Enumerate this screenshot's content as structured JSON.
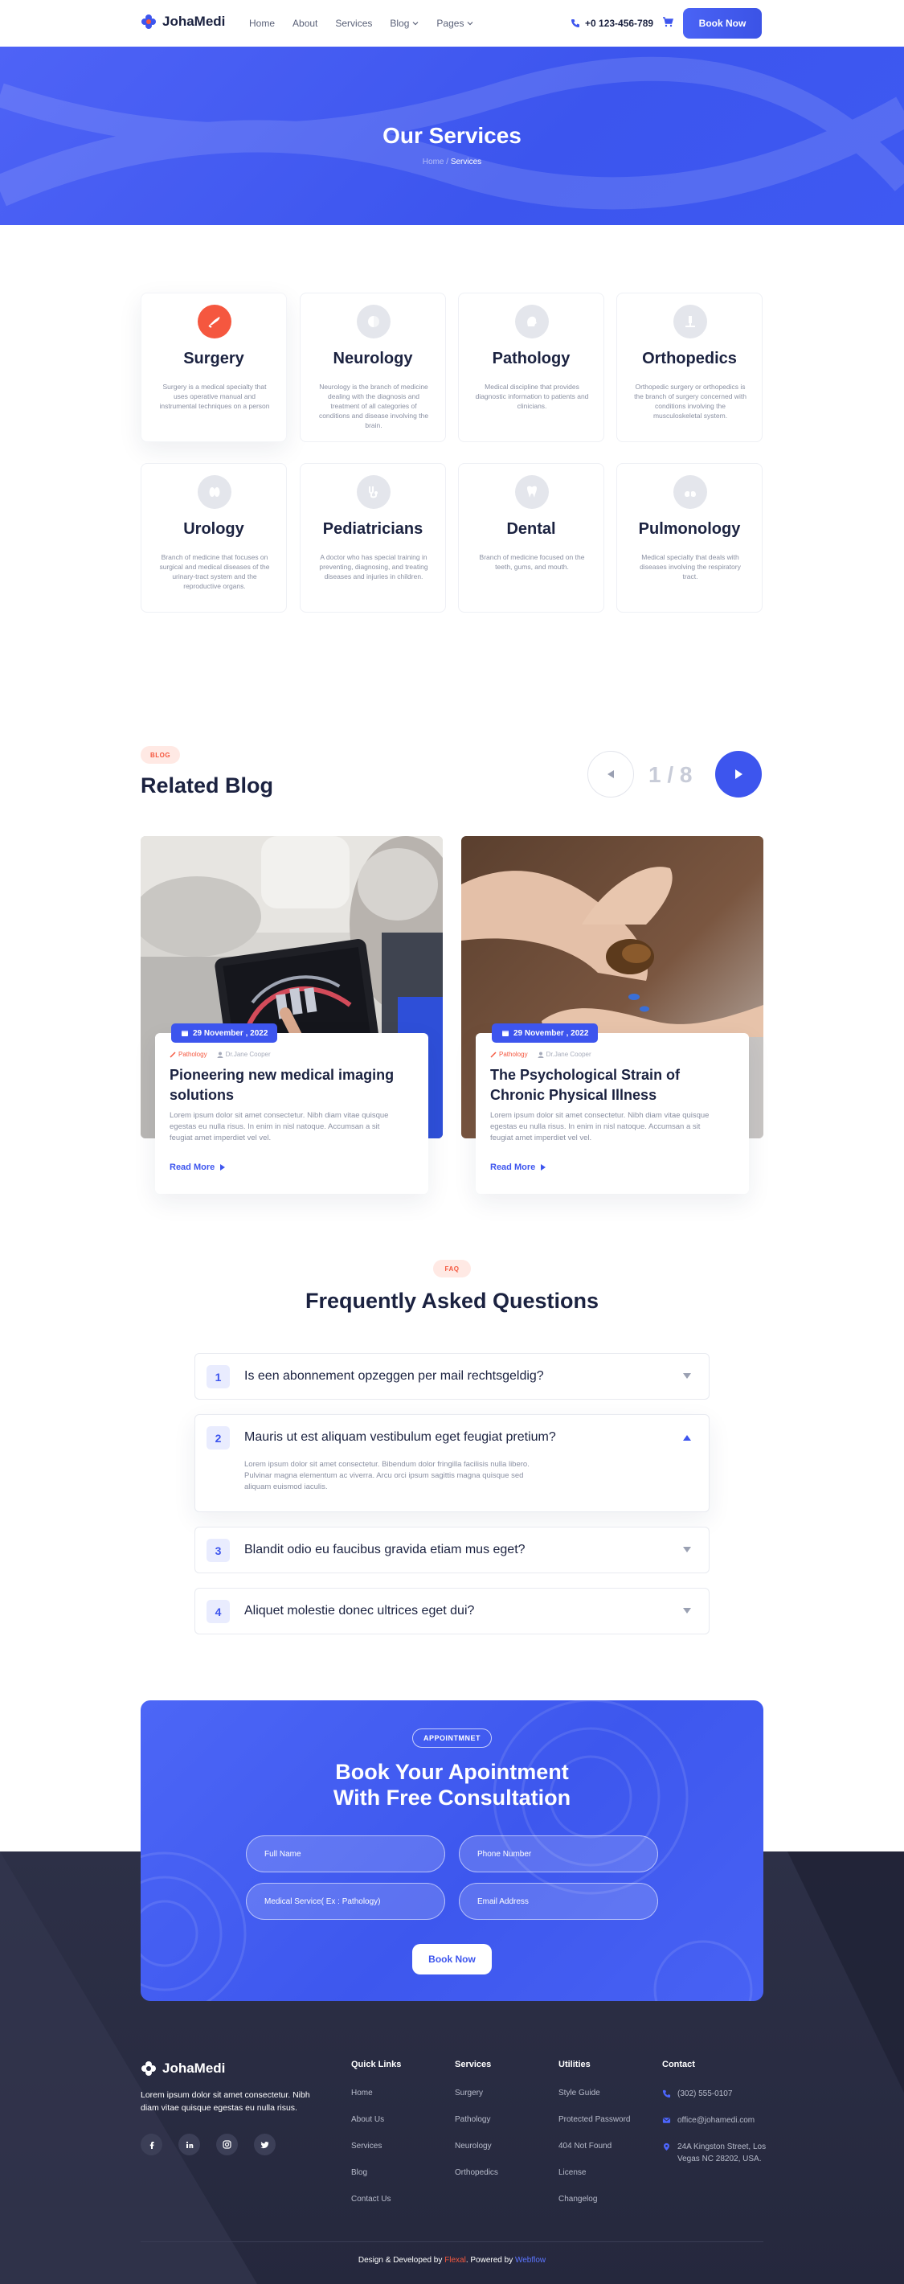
{
  "header": {
    "brand": "JohaMedi",
    "nav": [
      {
        "label": "Home"
      },
      {
        "label": "About"
      },
      {
        "label": "Services"
      },
      {
        "label": "Blog"
      },
      {
        "label": "Pages"
      }
    ],
    "phone": "+0 123-456-789",
    "book_now": "Book Now"
  },
  "hero": {
    "title": "Our Services",
    "breadcrumb_home": "Home",
    "breadcrumb_sep": "/",
    "breadcrumb_current": "Services"
  },
  "services": [
    {
      "title": "Surgery",
      "desc": "Surgery is a medical specialty that uses operative manual and instrumental techniques on a person",
      "icon": "scalpel-icon",
      "active": true
    },
    {
      "title": "Neurology",
      "desc": "Neurology is the branch of medicine dealing with the diagnosis and treatment of all categories of conditions and disease involving the brain.",
      "icon": "brain-icon",
      "active": false
    },
    {
      "title": "Pathology",
      "desc": "Medical discipline that provides diagnostic information to patients and clinicians.",
      "icon": "head-icon",
      "active": false
    },
    {
      "title": "Orthopedics",
      "desc": "Orthopedic surgery or orthopedics is the branch of surgery concerned with conditions involving the musculoskeletal system.",
      "icon": "microscope-icon",
      "active": false
    },
    {
      "title": "Urology",
      "desc": "Branch of medicine that focuses on surgical and medical diseases of the urinary-tract system and the reproductive organs.",
      "icon": "kidney-icon",
      "active": false
    },
    {
      "title": "Pediatricians",
      "desc": "A doctor who has special training in preventing, diagnosing, and treating diseases and injuries in children.",
      "icon": "stethoscope-icon",
      "active": false
    },
    {
      "title": "Dental",
      "desc": "Branch of medicine focused on the teeth, gums, and mouth.",
      "icon": "tooth-icon",
      "active": false
    },
    {
      "title": "Pulmonology",
      "desc": "Medical specialty that deals with diseases involving the respiratory tract.",
      "icon": "lungs-icon",
      "active": false
    }
  ],
  "blog": {
    "pill": "BLOG",
    "title": "Related Blog",
    "page_current": "1",
    "page_sep": "/",
    "page_total": "8",
    "posts": [
      {
        "date": "29 November , 2022",
        "category": "Pathology",
        "author": "Dr.Jane Cooper",
        "title": "Pioneering new medical imaging solutions",
        "excerpt": "Lorem ipsum dolor sit amet consectetur. Nibh diam vitae quisque egestas eu nulla risus. In enim in nisl natoque. Accumsan a sit feugiat amet imperdiet vel vel.",
        "read_more": "Read More"
      },
      {
        "date": "29 November , 2022",
        "category": "Pathology",
        "author": "Dr.Jane Cooper",
        "title": "The Psychological Strain of Chronic Physical Illness",
        "excerpt": "Lorem ipsum dolor sit amet consectetur. Nibh diam vitae quisque egestas eu nulla risus. In enim in nisl natoque. Accumsan a sit feugiat amet imperdiet vel vel.",
        "read_more": "Read More"
      }
    ]
  },
  "faq": {
    "pill": "FAQ",
    "title": "Frequently Asked Questions",
    "items": [
      {
        "num": "1",
        "question": "Is een abonnement opzeggen per mail rechtsgeldig?",
        "answer": "",
        "open": false
      },
      {
        "num": "2",
        "question": "Mauris ut est aliquam vestibulum eget feugiat pretium?",
        "answer": "Lorem ipsum dolor sit amet consectetur. Bibendum dolor fringilla facilisis nulla libero. Pulvinar magna elementum ac viverra. Arcu orci ipsum sagittis magna quisque sed aliquam euismod iaculis.",
        "open": true
      },
      {
        "num": "3",
        "question": "Blandit odio eu faucibus gravida etiam mus eget?",
        "answer": "",
        "open": false
      },
      {
        "num": "4",
        "question": "Aliquet molestie donec ultrices eget dui?",
        "answer": "",
        "open": false
      }
    ]
  },
  "appointment": {
    "pill": "APPOINTMNET",
    "title_line1": "Book Your Apointment",
    "title_line2": "With Free Consultation",
    "full_name_placeholder": "Full Name",
    "phone_placeholder": "Phone Number",
    "service_placeholder": "Medical Service( Ex : Pathology)",
    "email_placeholder": "Email Address",
    "button": "Book Now"
  },
  "footer": {
    "brand": "JohaMedi",
    "desc": "Lorem ipsum dolor sit amet consectetur. Nibh diam vitae quisque egestas eu nulla risus.",
    "socials": [
      "facebook-icon",
      "linkedin-icon",
      "instagram-icon",
      "twitter-icon"
    ],
    "quick_links": {
      "title": "Quick Links",
      "items": [
        "Home",
        "About Us",
        "Services",
        "Blog",
        "Contact Us"
      ]
    },
    "services": {
      "title": "Services",
      "items": [
        "Surgery",
        "Pathology",
        "Neurology",
        "Orthopedics"
      ]
    },
    "utilities": {
      "title": "Utilities",
      "items": [
        "Style Guide",
        "Protected Password",
        "404 Not Found",
        "License",
        "Changelog"
      ]
    },
    "contact": {
      "title": "Contact",
      "phone": "(302) 555-0107",
      "email": "office@johamedi.com",
      "address": "24A Kingston Street, Los Vegas NC 28202, USA."
    },
    "copy_prefix": "Design & Developed by ",
    "copy_brand": "Flexal",
    "copy_mid": ". Powered by ",
    "copy_platform": "Webflow"
  },
  "colors": {
    "primary": "#3d55ee",
    "accent": "#f5573f",
    "dark": "#1b2240",
    "footer": "#2a2d44"
  }
}
